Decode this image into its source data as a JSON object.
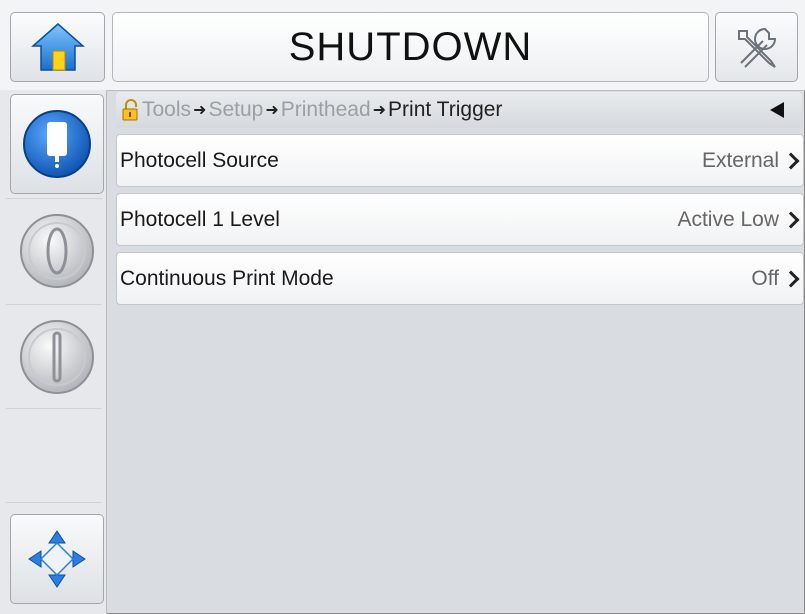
{
  "header": {
    "title": "SHUTDOWN",
    "home_icon": "home-icon",
    "tools_icon": "tools-icon"
  },
  "sidebar": {
    "items": [
      {
        "name": "ink-status-button",
        "icon": "ink-cartridge-icon"
      },
      {
        "name": "start-button",
        "icon": "zero-power-icon"
      },
      {
        "name": "stop-button",
        "icon": "one-power-icon"
      },
      {
        "name": "empty-slot",
        "icon": ""
      },
      {
        "name": "navigation-button",
        "icon": "four-way-arrows-icon"
      }
    ]
  },
  "breadcrumb": {
    "items": [
      "Tools",
      "Setup",
      "Printhead",
      "Print Trigger"
    ],
    "lock_icon": "lock-icon",
    "back_icon": "back-arrow-icon"
  },
  "settings": [
    {
      "label": "Photocell Source",
      "value": "External"
    },
    {
      "label": "Photocell 1 Level",
      "value": "Active Low"
    },
    {
      "label": "Continuous Print Mode",
      "value": "Off"
    }
  ],
  "colors": {
    "accent_blue": "#1f6fd1",
    "background": "#d9dde2"
  }
}
